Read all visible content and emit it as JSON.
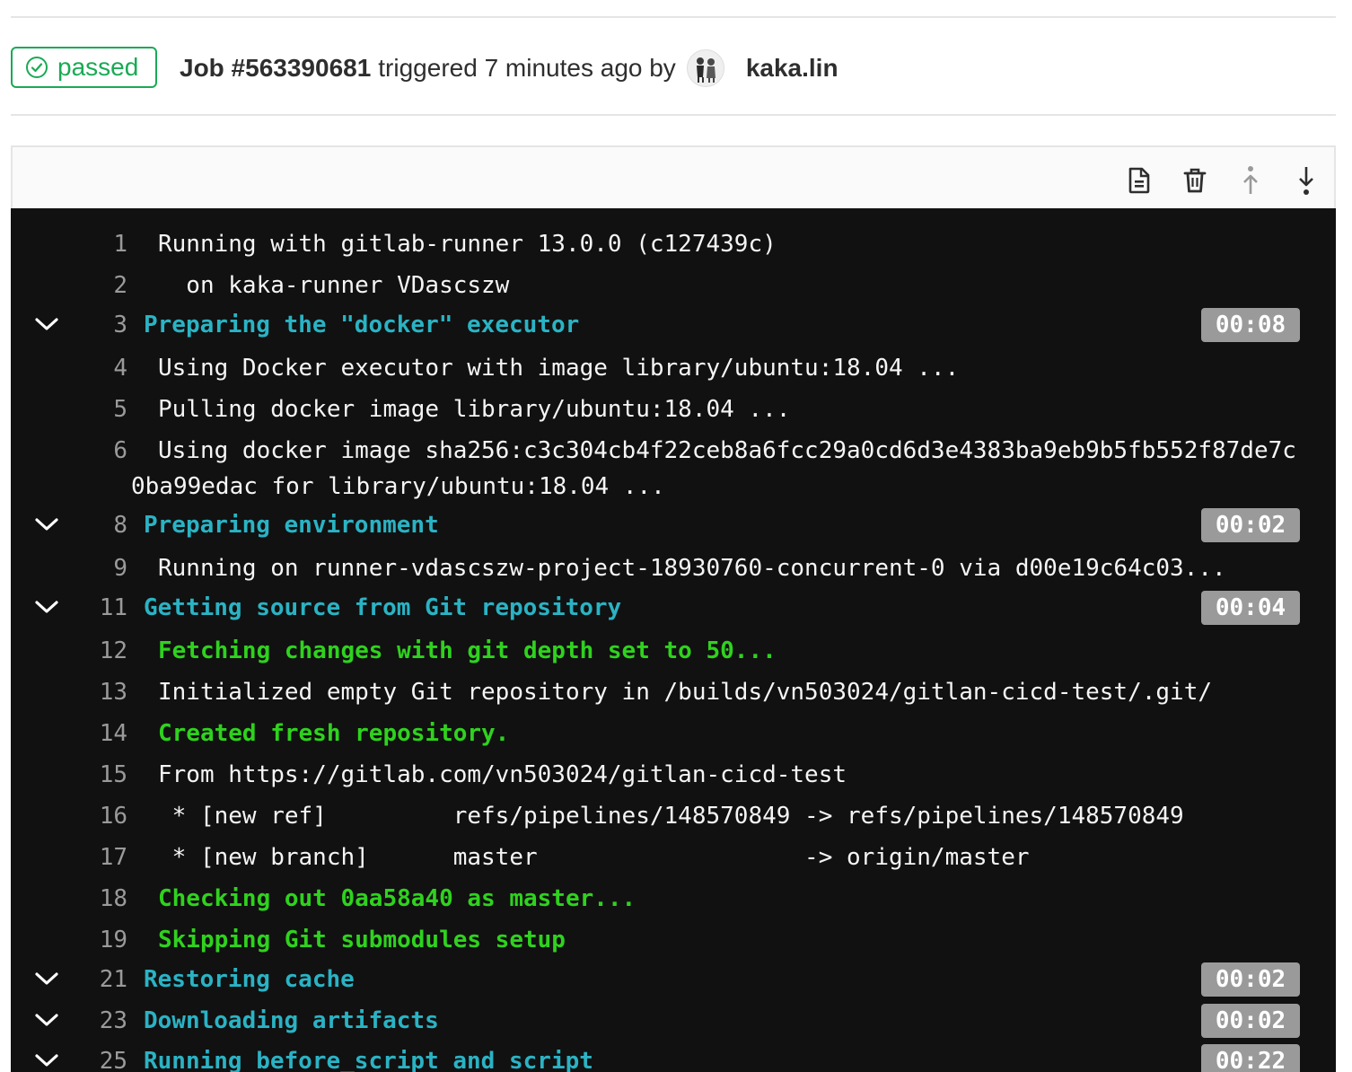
{
  "header": {
    "status": "passed",
    "job_id": "Job #563390681",
    "triggered_text": "triggered 7 minutes ago by",
    "user": "kaka.lin"
  },
  "toolbar": {
    "icons": [
      "raw-log-icon",
      "erase-log-icon",
      "scroll-to-top-icon",
      "scroll-to-bottom-icon"
    ]
  },
  "colors": {
    "success": "#1aaa55",
    "section_header": "#2ab3c4",
    "green_output": "#2fd21e",
    "log_background": "#111111",
    "duration_badge": "#9a9a9a"
  },
  "log": {
    "lines": [
      {
        "num": "1",
        "text": "Running with gitlab-runner 13.0.0 (c127439c)"
      },
      {
        "num": "2",
        "text": "  on kaka-runner VDascszw"
      },
      {
        "num": "3",
        "text": "Preparing the \"docker\" executor",
        "duration": "00:08"
      },
      {
        "num": "4",
        "text": "Using Docker executor with image library/ubuntu:18.04 ..."
      },
      {
        "num": "5",
        "text": "Pulling docker image library/ubuntu:18.04 ..."
      },
      {
        "num": "6",
        "text": "Using docker image sha256:c3c304cb4f22ceb8a6fcc29a0cd6d3e4383ba9eb9b5fb552f87de7c",
        "wrap": "0ba99edac for library/ubuntu:18.04 ..."
      },
      {
        "num": "8",
        "text": "Preparing environment",
        "duration": "00:02"
      },
      {
        "num": "9",
        "text": "Running on runner-vdascszw-project-18930760-concurrent-0 via d00e19c64c03..."
      },
      {
        "num": "11",
        "text": "Getting source from Git repository",
        "duration": "00:04"
      },
      {
        "num": "12",
        "text": "Fetching changes with git depth set to 50..."
      },
      {
        "num": "13",
        "text": "Initialized empty Git repository in /builds/vn503024/gitlan-cicd-test/.git/"
      },
      {
        "num": "14",
        "text": "Created fresh repository."
      },
      {
        "num": "15",
        "text": "From https://gitlab.com/vn503024/gitlan-cicd-test"
      },
      {
        "num": "16",
        "text": " * [new ref]         refs/pipelines/148570849 -> refs/pipelines/148570849"
      },
      {
        "num": "17",
        "text": " * [new branch]      master                   -> origin/master"
      },
      {
        "num": "18",
        "text": "Checking out 0aa58a40 as master..."
      },
      {
        "num": "19",
        "text": "Skipping Git submodules setup"
      },
      {
        "num": "21",
        "text": "Restoring cache",
        "duration": "00:02"
      },
      {
        "num": "23",
        "text": "Downloading artifacts",
        "duration": "00:02"
      },
      {
        "num": "25",
        "text": "Running before_script and script",
        "duration": "00:22"
      }
    ]
  }
}
